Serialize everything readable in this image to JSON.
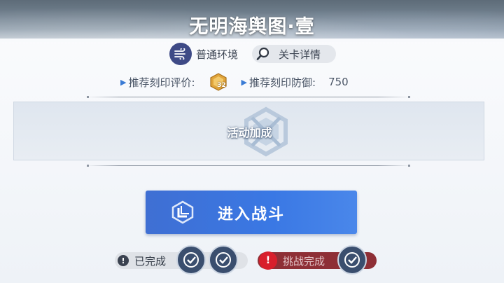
{
  "stage": {
    "title": "无明海舆图·壹"
  },
  "environment": {
    "label": "普通环境",
    "icon": "wind-icon"
  },
  "details": {
    "label": "关卡详情",
    "icon": "search-icon"
  },
  "recommend": {
    "rating_label": "推荐刻印评价:",
    "rating_value": "32",
    "defense_label": "推荐刻印防御:",
    "defense_value": "750"
  },
  "bonus": {
    "label": "活动加成"
  },
  "action": {
    "enter_label": "进入战斗"
  },
  "status": {
    "completed_label": "已完成",
    "challenge_label": "挑战完成"
  },
  "colors": {
    "button_blue": "#3a78e4",
    "challenge_red": "#8e2f36",
    "env_icon": "#3e4a86"
  }
}
